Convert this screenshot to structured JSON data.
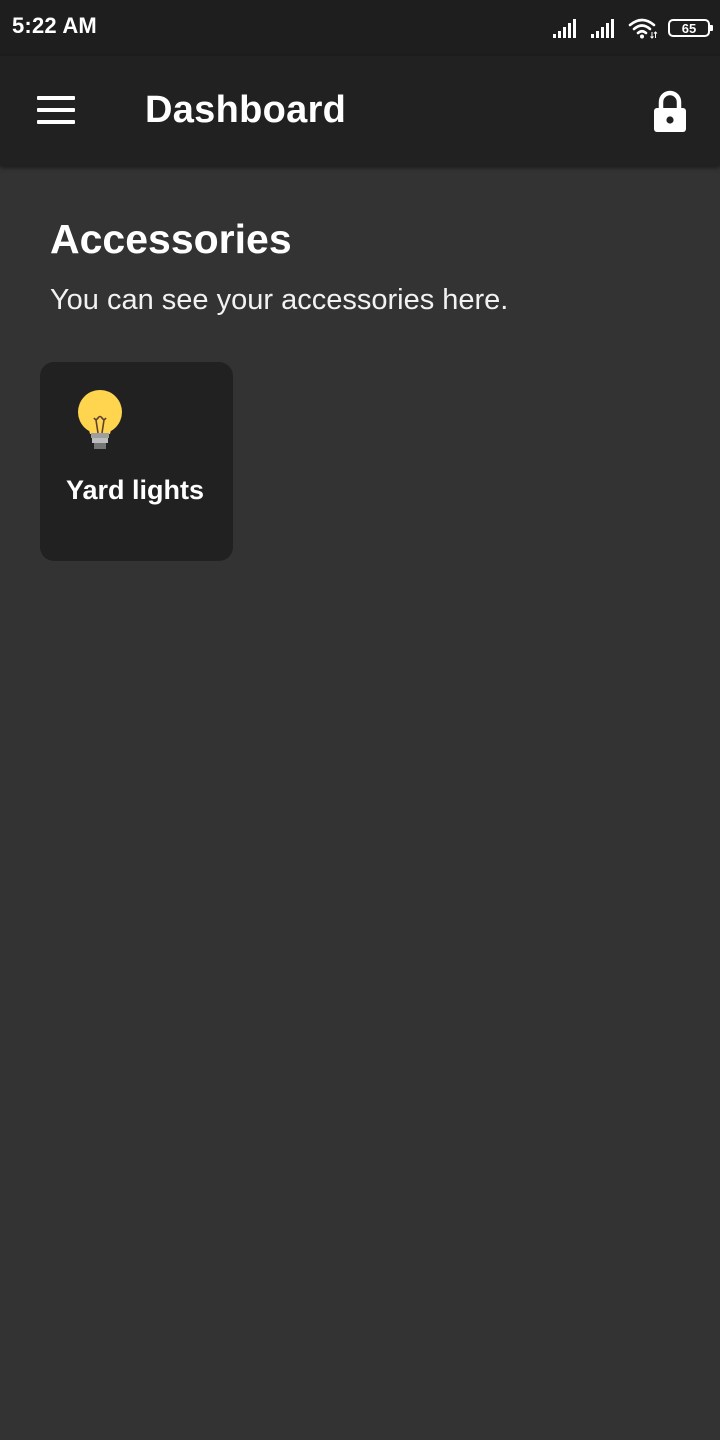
{
  "status_bar": {
    "time": "5:22 AM",
    "battery_level": "65",
    "icons": [
      "signal-icon",
      "signal-icon",
      "wifi-icon",
      "battery-icon"
    ]
  },
  "app_bar": {
    "title": "Dashboard",
    "menu_icon": "menu-icon",
    "lock_icon": "lock-icon"
  },
  "main": {
    "section_title": "Accessories",
    "section_subtitle": "You can see your accessories here.",
    "accessories": [
      {
        "name": "Yard lights",
        "icon": "light-bulb-icon"
      }
    ]
  },
  "colors": {
    "background": "#333333",
    "app_bar": "#212121",
    "status_bar": "#1e1e1e",
    "card": "#212121",
    "bulb": "#ffd54f"
  }
}
